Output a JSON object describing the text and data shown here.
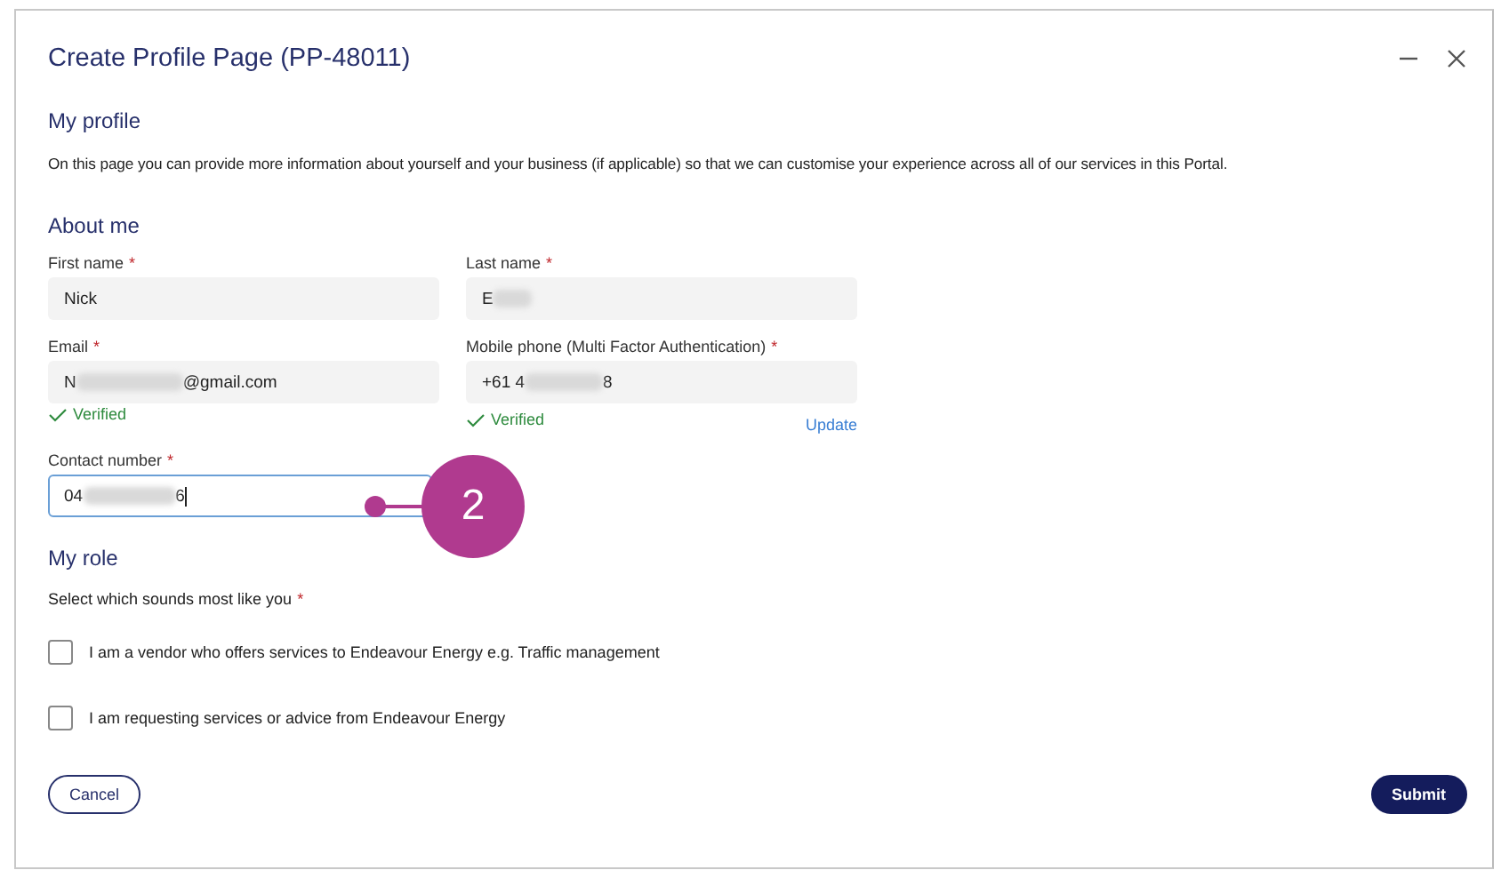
{
  "window": {
    "title": "Create Profile Page (PP-48011)"
  },
  "sections": [
    {
      "heading": "My profile",
      "text": "On this page you can provide more information about yourself and your business (if applicable) so that we can customise your experience across all of our services in this Portal."
    }
  ],
  "about": {
    "heading": "About me",
    "fields": [
      {
        "label": "First name",
        "required_mark": "*",
        "value_start": "Nick",
        "redacted": false,
        "focused": false
      },
      {
        "label": "Last name",
        "required_mark": "*",
        "value_start": "E",
        "redacted": true,
        "focused": false
      },
      {
        "label": "Email",
        "required_mark": "*",
        "value_start": "N",
        "redacted": true,
        "value_end": "@gmail.com",
        "verified": "Verified",
        "focused": false
      },
      {
        "label": "Mobile phone (Multi Factor Authentication)",
        "required_mark": "*",
        "value_start": "+61 4",
        "redacted": true,
        "value_end": "8",
        "verified": "Verified",
        "link": "Update",
        "focused": false
      },
      {
        "label": "Contact number",
        "required_mark": "*",
        "value_start": "04",
        "redacted": true,
        "value_end": "6",
        "focused": true
      }
    ]
  },
  "callout": {
    "number": "2"
  },
  "role": {
    "heading": "My role",
    "prompt": "Select which sounds most like you",
    "required_mark": "*",
    "options": [
      {
        "label": "I am a vendor who offers services to Endeavour Energy e.g. Traffic management",
        "checked": false
      },
      {
        "label": "I am requesting services or advice from Endeavour Energy",
        "checked": false
      }
    ]
  },
  "buttons": [
    {
      "label": "Cancel",
      "kind": "secondary"
    },
    {
      "label": "Submit",
      "kind": "primary"
    }
  ]
}
